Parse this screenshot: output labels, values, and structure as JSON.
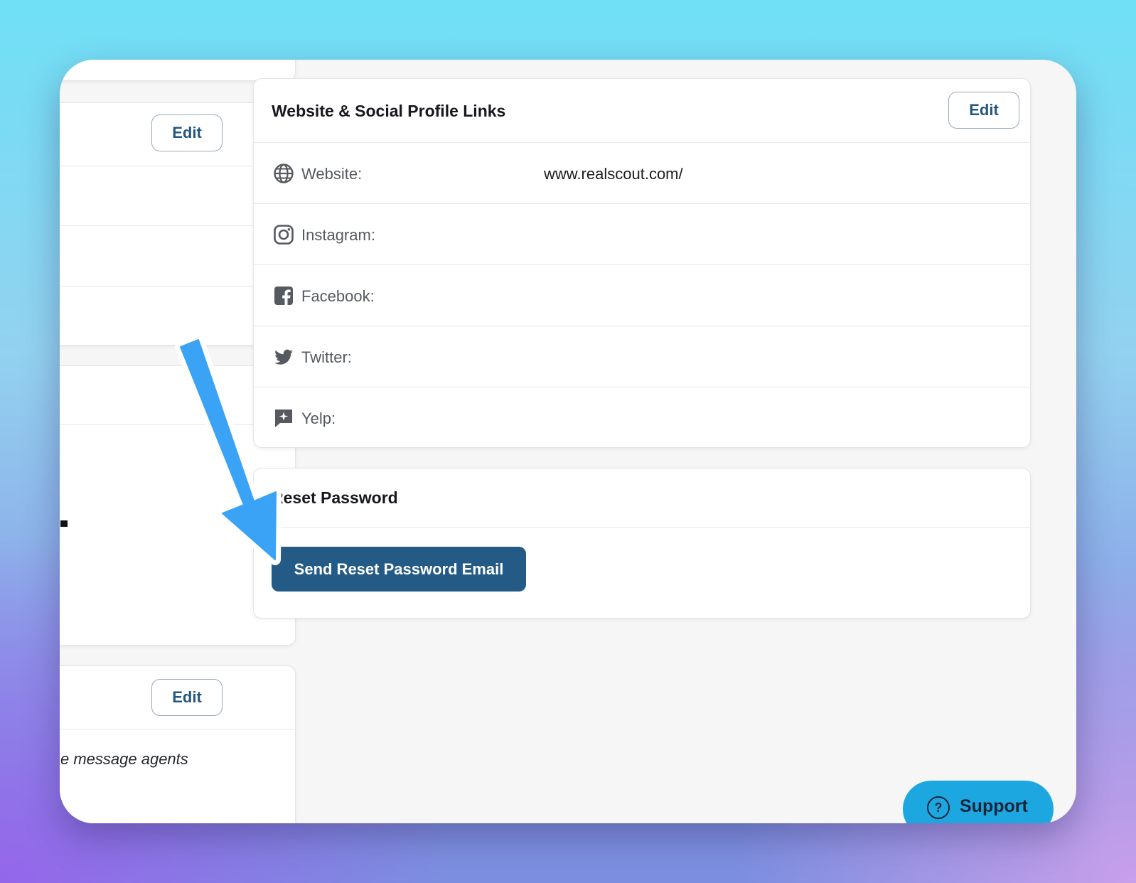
{
  "left_column": {
    "card_edit_label": "Edit",
    "bottom_card_edit_label": "Edit",
    "bottom_card_text": "e message agents"
  },
  "social_links": {
    "title": "Website & Social Profile Links",
    "edit_label": "Edit",
    "rows": [
      {
        "label": "Website:",
        "value": "www.realscout.com/",
        "icon": "globe-icon"
      },
      {
        "label": "Instagram:",
        "value": "",
        "icon": "instagram-icon"
      },
      {
        "label": "Facebook:",
        "value": "",
        "icon": "facebook-icon"
      },
      {
        "label": "Twitter:",
        "value": "",
        "icon": "twitter-icon"
      },
      {
        "label": "Yelp:",
        "value": "",
        "icon": "yelp-icon"
      }
    ]
  },
  "reset_password": {
    "title": "Reset Password",
    "button_label": "Send Reset Password Email"
  },
  "support": {
    "label": "Support",
    "icon": "question-circle-icon"
  },
  "annotation": {
    "arrow_color": "#3aa3f5",
    "icon": "arrow-annotation"
  },
  "colors": {
    "accent": "#245b86",
    "support": "#1da7e0"
  }
}
